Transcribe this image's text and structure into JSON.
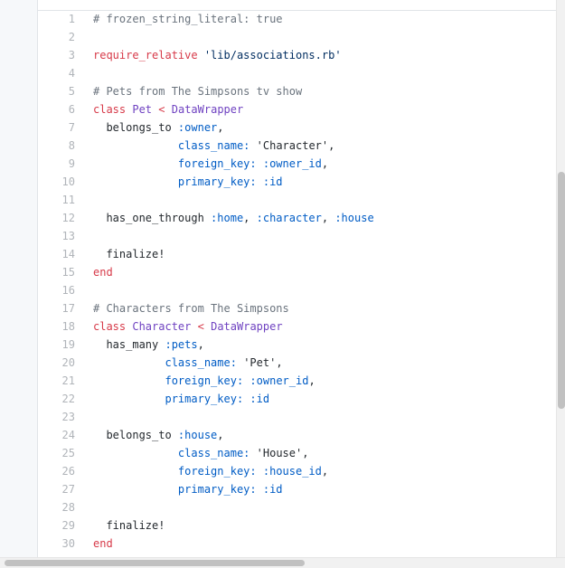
{
  "colors": {
    "comment": "#6a737d",
    "keyword": "#d73a49",
    "constant": "#6f42c1",
    "symbol": "#005cc5",
    "string": "#032f62",
    "plain": "#24292e",
    "line_number": "#b0b4b9"
  },
  "code": {
    "lines": [
      {
        "n": "1",
        "tokens": [
          {
            "t": "# frozen_string_literal: true",
            "c": "comment"
          }
        ]
      },
      {
        "n": "2",
        "tokens": []
      },
      {
        "n": "3",
        "tokens": [
          {
            "t": "require_relative",
            "c": "keyword"
          },
          {
            "t": " ",
            "c": "plain"
          },
          {
            "t": "'lib/associations.rb'",
            "c": "string"
          }
        ]
      },
      {
        "n": "4",
        "tokens": []
      },
      {
        "n": "5",
        "tokens": [
          {
            "t": "# Pets from The Simpsons tv show",
            "c": "comment"
          }
        ]
      },
      {
        "n": "6",
        "tokens": [
          {
            "t": "class",
            "c": "keyword"
          },
          {
            "t": " ",
            "c": "plain"
          },
          {
            "t": "Pet",
            "c": "constant"
          },
          {
            "t": " ",
            "c": "plain"
          },
          {
            "t": "<",
            "c": "keyword"
          },
          {
            "t": " ",
            "c": "plain"
          },
          {
            "t": "DataWrapper",
            "c": "constant"
          }
        ]
      },
      {
        "n": "7",
        "tokens": [
          {
            "t": "  belongs_to ",
            "c": "plain"
          },
          {
            "t": ":owner",
            "c": "symbol"
          },
          {
            "t": ",",
            "c": "plain"
          }
        ]
      },
      {
        "n": "8",
        "tokens": [
          {
            "t": "             ",
            "c": "plain"
          },
          {
            "t": "class_name:",
            "c": "symbol"
          },
          {
            "t": " ",
            "c": "plain"
          },
          {
            "t": "'Character'",
            "c": "plain"
          },
          {
            "t": ",",
            "c": "plain"
          }
        ]
      },
      {
        "n": "9",
        "tokens": [
          {
            "t": "             ",
            "c": "plain"
          },
          {
            "t": "foreign_key:",
            "c": "symbol"
          },
          {
            "t": " ",
            "c": "plain"
          },
          {
            "t": ":owner_id",
            "c": "symbol"
          },
          {
            "t": ",",
            "c": "plain"
          }
        ]
      },
      {
        "n": "10",
        "tokens": [
          {
            "t": "             ",
            "c": "plain"
          },
          {
            "t": "primary_key:",
            "c": "symbol"
          },
          {
            "t": " ",
            "c": "plain"
          },
          {
            "t": ":id",
            "c": "symbol"
          }
        ]
      },
      {
        "n": "11",
        "tokens": []
      },
      {
        "n": "12",
        "tokens": [
          {
            "t": "  has_one_through ",
            "c": "plain"
          },
          {
            "t": ":home",
            "c": "symbol"
          },
          {
            "t": ", ",
            "c": "plain"
          },
          {
            "t": ":character",
            "c": "symbol"
          },
          {
            "t": ", ",
            "c": "plain"
          },
          {
            "t": ":house",
            "c": "symbol"
          }
        ]
      },
      {
        "n": "13",
        "tokens": []
      },
      {
        "n": "14",
        "tokens": [
          {
            "t": "  finalize!",
            "c": "plain"
          }
        ]
      },
      {
        "n": "15",
        "tokens": [
          {
            "t": "end",
            "c": "keyword"
          }
        ]
      },
      {
        "n": "16",
        "tokens": []
      },
      {
        "n": "17",
        "tokens": [
          {
            "t": "# Characters from The Simpsons",
            "c": "comment"
          }
        ]
      },
      {
        "n": "18",
        "tokens": [
          {
            "t": "class",
            "c": "keyword"
          },
          {
            "t": " ",
            "c": "plain"
          },
          {
            "t": "Character",
            "c": "constant"
          },
          {
            "t": " ",
            "c": "plain"
          },
          {
            "t": "<",
            "c": "keyword"
          },
          {
            "t": " ",
            "c": "plain"
          },
          {
            "t": "DataWrapper",
            "c": "constant"
          }
        ]
      },
      {
        "n": "19",
        "tokens": [
          {
            "t": "  has_many ",
            "c": "plain"
          },
          {
            "t": ":pets",
            "c": "symbol"
          },
          {
            "t": ",",
            "c": "plain"
          }
        ]
      },
      {
        "n": "20",
        "tokens": [
          {
            "t": "           ",
            "c": "plain"
          },
          {
            "t": "class_name:",
            "c": "symbol"
          },
          {
            "t": " ",
            "c": "plain"
          },
          {
            "t": "'Pet'",
            "c": "plain"
          },
          {
            "t": ",",
            "c": "plain"
          }
        ]
      },
      {
        "n": "21",
        "tokens": [
          {
            "t": "           ",
            "c": "plain"
          },
          {
            "t": "foreign_key:",
            "c": "symbol"
          },
          {
            "t": " ",
            "c": "plain"
          },
          {
            "t": ":owner_id",
            "c": "symbol"
          },
          {
            "t": ",",
            "c": "plain"
          }
        ]
      },
      {
        "n": "22",
        "tokens": [
          {
            "t": "           ",
            "c": "plain"
          },
          {
            "t": "primary_key:",
            "c": "symbol"
          },
          {
            "t": " ",
            "c": "plain"
          },
          {
            "t": ":id",
            "c": "symbol"
          }
        ]
      },
      {
        "n": "23",
        "tokens": []
      },
      {
        "n": "24",
        "tokens": [
          {
            "t": "  belongs_to ",
            "c": "plain"
          },
          {
            "t": ":house",
            "c": "symbol"
          },
          {
            "t": ",",
            "c": "plain"
          }
        ]
      },
      {
        "n": "25",
        "tokens": [
          {
            "t": "             ",
            "c": "plain"
          },
          {
            "t": "class_name:",
            "c": "symbol"
          },
          {
            "t": " ",
            "c": "plain"
          },
          {
            "t": "'House'",
            "c": "plain"
          },
          {
            "t": ",",
            "c": "plain"
          }
        ]
      },
      {
        "n": "26",
        "tokens": [
          {
            "t": "             ",
            "c": "plain"
          },
          {
            "t": "foreign_key:",
            "c": "symbol"
          },
          {
            "t": " ",
            "c": "plain"
          },
          {
            "t": ":house_id",
            "c": "symbol"
          },
          {
            "t": ",",
            "c": "plain"
          }
        ]
      },
      {
        "n": "27",
        "tokens": [
          {
            "t": "             ",
            "c": "plain"
          },
          {
            "t": "primary_key:",
            "c": "symbol"
          },
          {
            "t": " ",
            "c": "plain"
          },
          {
            "t": ":id",
            "c": "symbol"
          }
        ]
      },
      {
        "n": "28",
        "tokens": []
      },
      {
        "n": "29",
        "tokens": [
          {
            "t": "  finalize!",
            "c": "plain"
          }
        ]
      },
      {
        "n": "30",
        "tokens": [
          {
            "t": "end",
            "c": "keyword"
          }
        ]
      }
    ]
  }
}
